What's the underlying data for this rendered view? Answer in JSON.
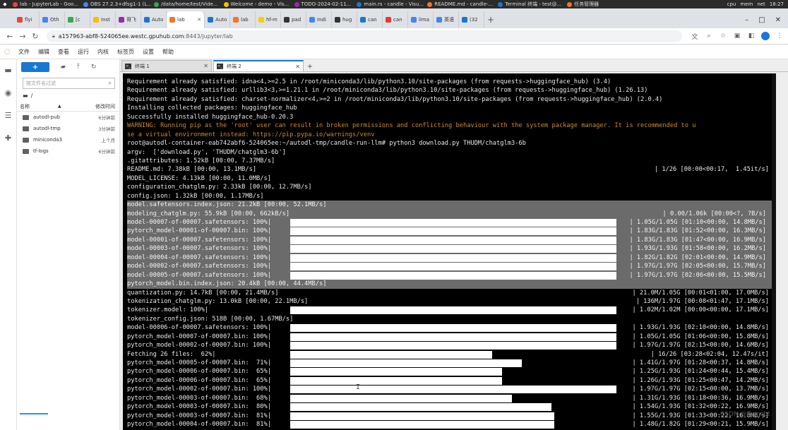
{
  "taskbar": {
    "items": [
      "lab - JupyterLab - Goo...",
      "OBS 27.2.3+dfsg1-1 (L...",
      "/data/home/test/Vide...",
      "Welcome - demo - Vis...",
      "TODO-2024-02-11...",
      "main.rs - candle - Visu...",
      "README.md - candle-...",
      "Terminal 终端 - test@...",
      "任务管理器"
    ],
    "tray": [
      "cpu",
      "mem",
      "net",
      "18:27"
    ]
  },
  "browser": {
    "tabs": [
      "flyi",
      "Oth",
      "[c",
      "Inst",
      "哥飞",
      "Auto",
      "lab",
      "Auto",
      "lab",
      "hf-m",
      "pad",
      "Indi",
      "hug",
      "can",
      "can",
      "lima",
      "英语",
      "(32"
    ],
    "active_tab": "lab",
    "url_host": "a157963-abf8-524065ee.westc.gpuhub.com",
    "url_path": ":8443/jupyter/lab"
  },
  "jupyter": {
    "menu": [
      "文件",
      "编辑",
      "查看",
      "运行",
      "内核",
      "标签页",
      "设置",
      "帮助"
    ],
    "filebrowser": {
      "new_label": "+",
      "search_placeholder": "按文件名过滤",
      "breadcrumb": "/",
      "col_name": "名称",
      "col_modified": "修改时间",
      "files": [
        {
          "name": "autodl-pub",
          "modified": "6分钟前"
        },
        {
          "name": "autodl-tmp",
          "modified": "3分钟前"
        },
        {
          "name": "miniconda3",
          "modified": "上个月"
        },
        {
          "name": "tf-logs",
          "modified": "6分钟前"
        }
      ]
    },
    "doc_tabs": [
      {
        "label": "终端 1",
        "active": false
      },
      {
        "label": "终端 2",
        "active": true
      }
    ]
  },
  "terminal": {
    "lines": [
      {
        "text": "Requirement already satisfied: idna<4,>=2.5 in /root/miniconda3/lib/python3.10/site-packages (from requests->huggingface_hub) (3.4)"
      },
      {
        "text": "Requirement already satisfied: urllib3<3,>=1.21.1 in /root/miniconda3/lib/python3.10/site-packages (from requests->huggingface_hub) (1.26.13)"
      },
      {
        "text": "Requirement already satisfied: charset-normalizer<4,>=2 in /root/miniconda3/lib/python3.10/site-packages (from requests->huggingface_hub) (2.0.4)"
      },
      {
        "text": "Installing collected packages: huggingface_hub"
      },
      {
        "text": "Successfully installed huggingface_hub-0.20.3"
      },
      {
        "text": "WARNING: Running pip as the 'root' user can result in broken permissions and conflicting behaviour with the system package manager. It is recommended to u",
        "style": "warn"
      },
      {
        "text": "se a virtual environment instead: https://pip.pypa.io/warnings/venv",
        "style": "warn"
      },
      {
        "text": "root@autodl-container-eab742abf6-524065ee:~/autodl-tmp/candle-run-llm# python3 download.py THUDM/chatglm3-6b"
      },
      {
        "text": "argv:  ['download.py', 'THUDM/chatglm3-6b']"
      },
      {
        "text": ".gitattributes: 1.52kB [00:00, 7.37MB/s]"
      },
      {
        "text": "README.md: 7.38kB [00:00, 13.1MB/s]",
        "right": "| 1/26 [00:00<00:17,  1.45it/s]"
      },
      {
        "text": "MODEL_LICENSE: 4.13kB [00:00, 11.0MB/s]"
      },
      {
        "text": "configuration_chatglm.py: 2.33kB [00:00, 12.7MB/s]"
      },
      {
        "text": "config.json: 1.32kB [00:00, 1.17MB/s]"
      },
      {
        "text": "model.safetensors.index.json: 21.2kB [00:00, 52.1MB/s]",
        "style": "sel"
      },
      {
        "text": "modeling_chatglm.py: 55.9kB [00:00, 662kB/s]",
        "right": "| 0.00/1.06k [00:00<?, ?B/s]",
        "style": "sel"
      },
      {
        "text": "model-00007-of-00007.safetensors: 100%|",
        "bar": [
          0.0,
          1.0
        ],
        "right": "| 1.05G/1.05G [01:10<00:00, 14.8MB/s]",
        "style": "sel"
      },
      {
        "text": "pytorch_model-00001-of-00007.bin: 100%|",
        "bar": [
          0.0,
          1.0
        ],
        "right": "| 1.83G/1.83G [01:52<00:00, 16.3MB/s]",
        "style": "sel"
      },
      {
        "text": "model-00001-of-00007.safetensors: 100%|",
        "bar": [
          0.0,
          1.0
        ],
        "right": "| 1.83G/1.83G [01:47<00:00, 16.9MB/s]",
        "style": "sel"
      },
      {
        "text": "model-00003-of-00007.safetensors: 100%|",
        "bar": [
          0.0,
          1.0
        ],
        "right": "| 1.93G/1.93G [01:58<00:00, 16.2MB/s]",
        "style": "sel"
      },
      {
        "text": "model-00004-of-00007.safetensors: 100%|",
        "bar": [
          0.0,
          1.0
        ],
        "right": "| 1.82G/1.82G [02:01<00:00, 14.9MB/s]",
        "style": "sel"
      },
      {
        "text": "model-00002-of-00007.safetensors: 100%|",
        "bar": [
          0.0,
          1.0
        ],
        "right": "| 1.97G/1.97G [02:05<00:00, 15.7MB/s]",
        "style": "sel"
      },
      {
        "text": "model-00005-of-00007.safetensors: 100%|",
        "bar": [
          0.0,
          1.0
        ],
        "right": "| 1.97G/1.97G [02:06<00:00, 15.5MB/s]",
        "style": "sel"
      },
      {
        "text": "pytorch_model.bin.index.json: 20.4kB [00:00, 44.4MB/s]",
        "style": "sel"
      },
      {
        "text": "quantization.py: 14.7kB [00:00, 21.4MB/s]",
        "right": "| 21.0M/1.05G [00:01<01:00, 17.0MB/s]"
      },
      {
        "text": "tokenization_chatglm.py: 13.0kB [00:00, 22.1MB/s]",
        "right": "| 136M/1.97G [00:08<01:47, 17.1MB/s]"
      },
      {
        "text": "tokenizer.model: 100%|",
        "bar": [
          0.0,
          1.0
        ],
        "right": "| 1.02M/1.02M [00:00<00:00, 17.1MB/s]"
      },
      {
        "text": "tokenizer_config.json: 518B [00:00, 1.67MB/s]"
      },
      {
        "text": "model-00006-of-00007.safetensors: 100%|",
        "bar": [
          0.0,
          1.0
        ],
        "right": "| 1.93G/1.93G [02:10<00:00, 14.8MB/s]"
      },
      {
        "text": "pytorch_model-00007-of-00007.bin: 100%|",
        "bar": [
          0.0,
          1.0
        ],
        "right": "| 1.05G/1.05G [01:06<00:00, 15.8MB/s]"
      },
      {
        "text": "pytorch_model-00002-of-00007.bin: 100%|",
        "bar": [
          0.0,
          1.0
        ],
        "right": "| 1.97G/1.97G [02:15<00:00, 14.6MB/s]"
      },
      {
        "text": "Fetching 26 files:  62%|",
        "bar": [
          0.0,
          0.62
        ],
        "right": "| 16/26 [03:28<02:04, 12.47s/it]"
      },
      {
        "text": "pytorch_model-00005-of-00007.bin:  71%|",
        "bar": [
          0.0,
          0.71
        ],
        "right": "| 1.41G/1.97G [01:28<00:37, 14.8MB/s]"
      },
      {
        "text": "pytorch_model-00006-of-00007.bin:  65%|",
        "bar": [
          0.0,
          0.65
        ],
        "right": "| 1.25G/1.93G [01:24<00:44, 15.4MB/s]"
      },
      {
        "text": "pytorch_model-00006-of-00007.bin:  65%|",
        "bar": [
          0.0,
          0.65
        ],
        "right": "| 1.26G/1.93G [01:25<00:47, 14.2MB/s]"
      },
      {
        "text": "pytorch_model-00002-of-00007.bin: 100%|",
        "bar": [
          0.0,
          1.0
        ],
        "right": "| 1.97G/1.97G [02:15<00:00, 13.7MB/s]"
      },
      {
        "text": "pytorch_model-00003-of-00007.bin:  68%|",
        "bar": [
          0.0,
          0.68
        ],
        "right": "| 1.31G/1.93G [01:18<00:36, 16.9MB/s]"
      },
      {
        "text": "pytorch_model-00003-of-00007.bin:  80%|",
        "bar": [
          0.0,
          0.8
        ],
        "right": "| 1.54G/1.93G [01:32<00:22, 16.9MB/s]"
      },
      {
        "text": "pytorch_model-00003-of-00007.bin:  81%|",
        "bar": [
          0.0,
          0.81
        ],
        "right": "| 1.55G/1.93G [01:33<00:22, 16.8MB/s]"
      },
      {
        "text": "pytorch_model-00004-of-00007.bin:  81%|",
        "bar": [
          0.0,
          0.81
        ],
        "right": "| 1.48G/1.82G [01:29<00:21, 15.9MB/s]"
      }
    ]
  },
  "watermark": "CSDN @flyinsbt",
  "colors": {
    "jupyter_accent": "#1976d2",
    "jupyter_logo": "#f37726",
    "warning": "#cc8a2a",
    "terminal_bg": "#000000",
    "selection": "#6b6b6b"
  }
}
